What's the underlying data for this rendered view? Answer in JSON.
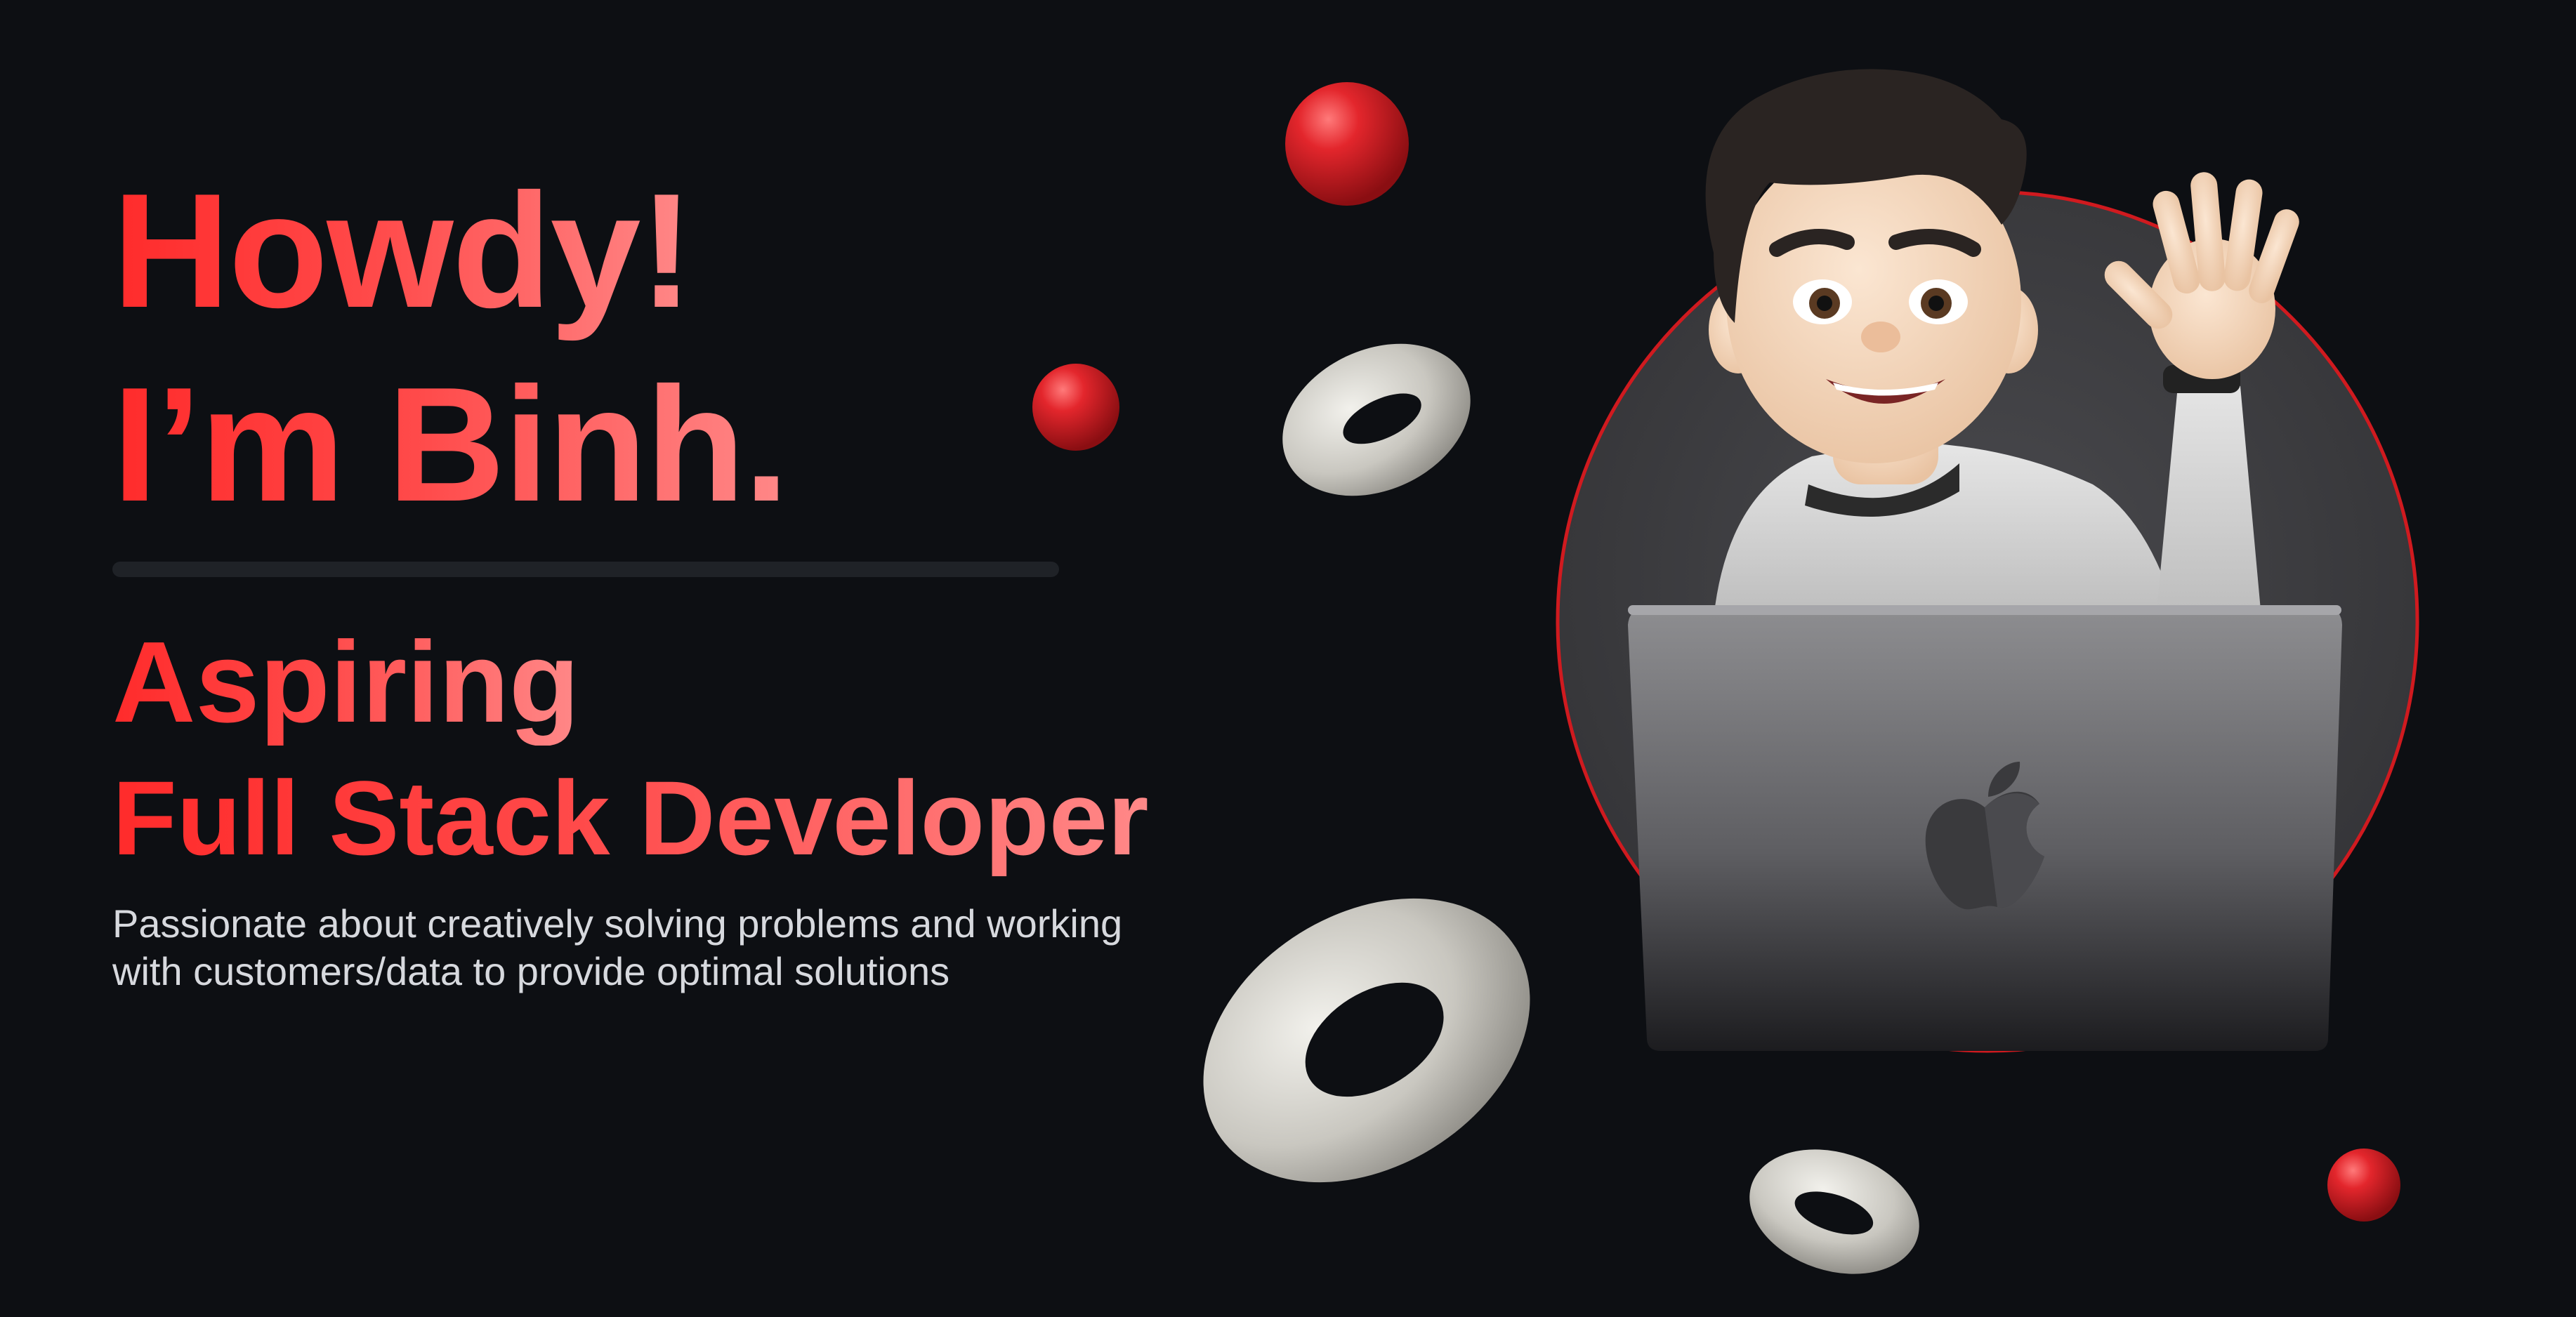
{
  "hero": {
    "greeting_line1": "Howdy!",
    "greeting_line2": "I’m Binh.",
    "role_prefix": "Aspiring",
    "role_title": "Full Stack Developer",
    "tagline_line1": "Passionate about creatively solving problems and working",
    "tagline_line2": "with customers/data to provide optimal solutions"
  },
  "colors": {
    "background": "#0d0f13",
    "accent": "#ff2b2b",
    "accent_light": "#ff8888",
    "text_muted": "#d7d9de",
    "divider": "#1f2227"
  },
  "illustration": {
    "avatar": "memoji-waving-avatar",
    "laptop": "laptop-with-apple-logo",
    "decorations": [
      "red-sphere",
      "gray-torus"
    ]
  }
}
